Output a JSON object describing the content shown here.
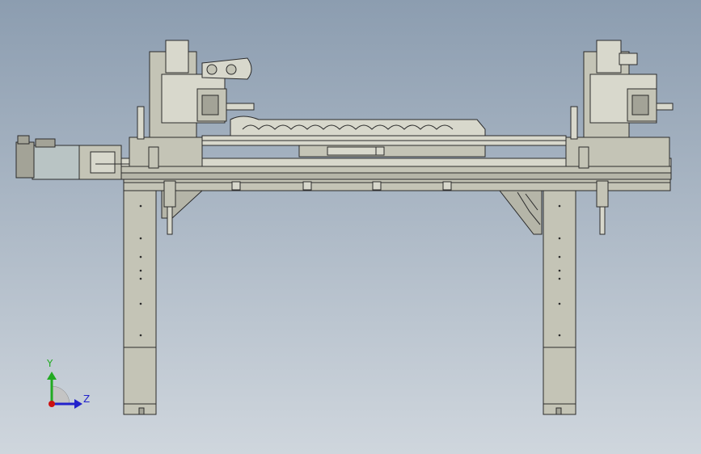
{
  "colors": {
    "background_top": "#8c9db0",
    "background_bottom": "#cfd6dd",
    "part_fill": "#c4c4b6",
    "part_light": "#d8d8cc",
    "part_dark": "#a3a397",
    "edge": "#2b2b2b",
    "motor_fill": "#b9c4c4",
    "axis_y": "#22aa22",
    "axis_z": "#2222cc",
    "axis_origin": "#cc1111"
  },
  "triad": {
    "y_label": "Y",
    "z_label": "Z",
    "icons": [
      "y-axis-arrow-icon",
      "z-axis-arrow-icon",
      "origin-point-icon"
    ]
  }
}
